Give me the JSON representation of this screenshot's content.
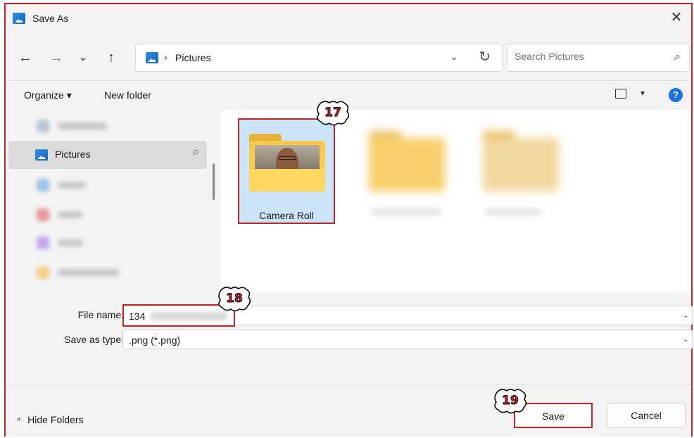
{
  "window": {
    "title": "Save As",
    "close_glyph": "✕"
  },
  "nav": {
    "back_glyph": "←",
    "forward_glyph": "→",
    "recent_glyph": "⌄",
    "up_glyph": "↑",
    "breadcrumb_sep": "›",
    "breadcrumb": "Pictures",
    "dropdown_glyph": "⌄",
    "refresh_glyph": "↻",
    "search_placeholder": "Search Pictures",
    "search_glyph": "⌕"
  },
  "commandbar": {
    "organize": "Organize ▾",
    "new_folder": "New folder",
    "view_dd": "▾",
    "help": "?"
  },
  "sidebar": {
    "selected_item": "Pictures",
    "pin_glyph": "📌"
  },
  "content": {
    "folders": [
      {
        "name": "Camera Roll",
        "selected": true
      }
    ]
  },
  "form": {
    "file_name_label": "File name:",
    "file_name_value": "134",
    "save_type_label": "Save as type:",
    "save_type_value": ".png (*.png)",
    "chevron": "⌄"
  },
  "footer": {
    "hide_folders": "Hide Folders",
    "caret": "^",
    "save": "Save",
    "cancel": "Cancel"
  },
  "callouts": [
    "17",
    "18",
    "19"
  ],
  "colors": {
    "highlight_red": "#c0272d",
    "selection_blue": "#cce4f7",
    "accent": "#1a73e8"
  }
}
